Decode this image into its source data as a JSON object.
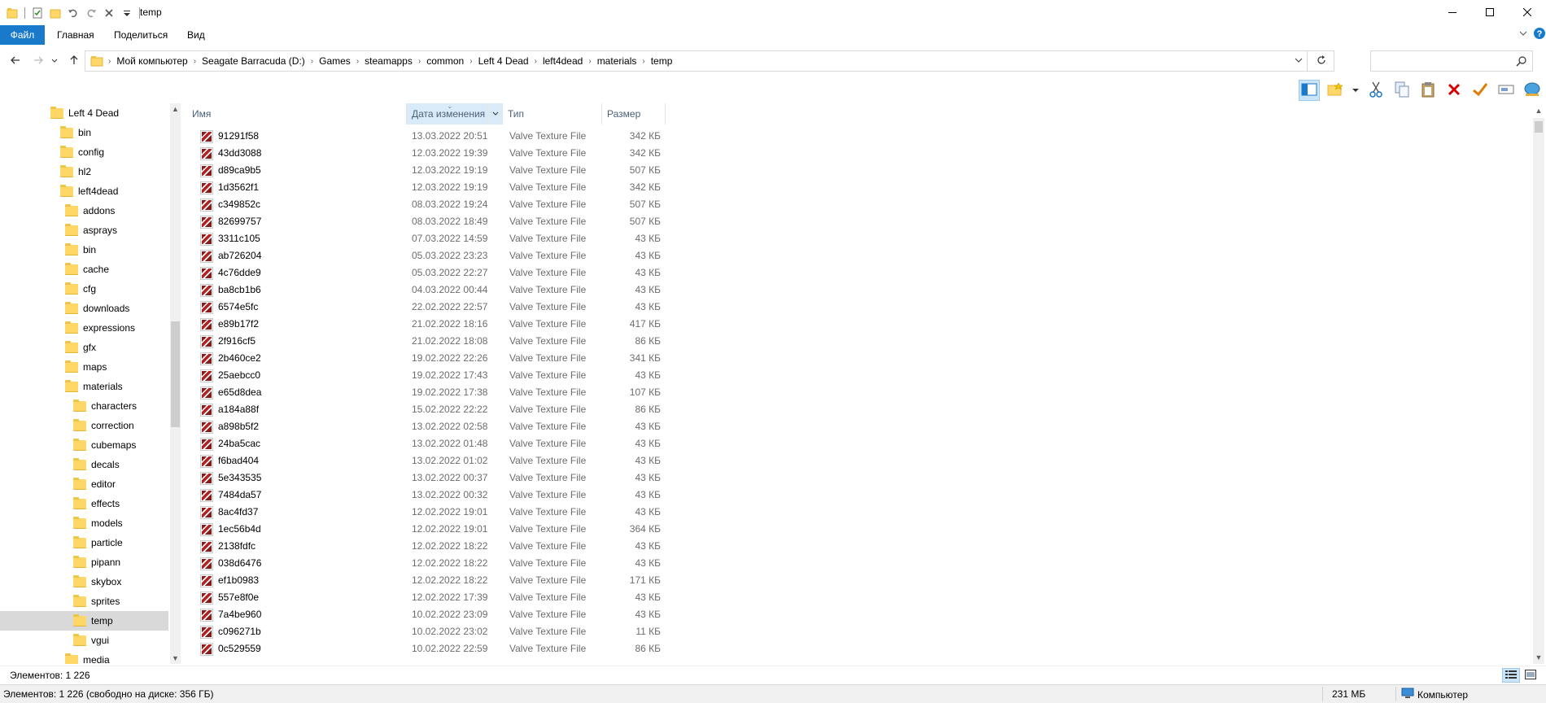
{
  "window": {
    "title": "temp",
    "min_icon": "minimize-icon",
    "max_icon": "maximize-icon",
    "close_icon": "close-icon"
  },
  "ribbon": {
    "tabs": [
      "Файл",
      "Главная",
      "Поделиться",
      "Вид"
    ]
  },
  "address": {
    "crumbs": [
      "Мой компьютер",
      "Seagate Barracuda (D:)",
      "Games",
      "steamapps",
      "common",
      "Left 4 Dead",
      "left4dead",
      "materials",
      "temp"
    ],
    "search_placeholder": ""
  },
  "nav": {
    "items": [
      {
        "label": "Left 4 Dead",
        "indent": 0
      },
      {
        "label": "bin",
        "indent": 1
      },
      {
        "label": "config",
        "indent": 1
      },
      {
        "label": "hl2",
        "indent": 1
      },
      {
        "label": "left4dead",
        "indent": 1
      },
      {
        "label": "addons",
        "indent": 2
      },
      {
        "label": "asprays",
        "indent": 2
      },
      {
        "label": "bin",
        "indent": 2
      },
      {
        "label": "cache",
        "indent": 2
      },
      {
        "label": "cfg",
        "indent": 2
      },
      {
        "label": "downloads",
        "indent": 2
      },
      {
        "label": "expressions",
        "indent": 2
      },
      {
        "label": "gfx",
        "indent": 2
      },
      {
        "label": "maps",
        "indent": 2
      },
      {
        "label": "materials",
        "indent": 2
      },
      {
        "label": "characters",
        "indent": 3
      },
      {
        "label": "correction",
        "indent": 3
      },
      {
        "label": "cubemaps",
        "indent": 3
      },
      {
        "label": "decals",
        "indent": 3
      },
      {
        "label": "editor",
        "indent": 3
      },
      {
        "label": "effects",
        "indent": 3
      },
      {
        "label": "models",
        "indent": 3
      },
      {
        "label": "particle",
        "indent": 3
      },
      {
        "label": "pipann",
        "indent": 3
      },
      {
        "label": "skybox",
        "indent": 3
      },
      {
        "label": "sprites",
        "indent": 3
      },
      {
        "label": "temp",
        "indent": 3,
        "selected": true
      },
      {
        "label": "vgui",
        "indent": 3
      },
      {
        "label": "media",
        "indent": 2
      }
    ]
  },
  "columns": {
    "name": "Имя",
    "date": "Дата изменения",
    "type": "Тип",
    "size": "Размер"
  },
  "files": [
    {
      "name": "91291f58",
      "date": "13.03.2022 20:51",
      "type": "Valve Texture File",
      "size": "342 КБ"
    },
    {
      "name": "43dd3088",
      "date": "12.03.2022 19:39",
      "type": "Valve Texture File",
      "size": "342 КБ"
    },
    {
      "name": "d89ca9b5",
      "date": "12.03.2022 19:19",
      "type": "Valve Texture File",
      "size": "507 КБ"
    },
    {
      "name": "1d3562f1",
      "date": "12.03.2022 19:19",
      "type": "Valve Texture File",
      "size": "342 КБ"
    },
    {
      "name": "c349852c",
      "date": "08.03.2022 19:24",
      "type": "Valve Texture File",
      "size": "507 КБ"
    },
    {
      "name": "82699757",
      "date": "08.03.2022 18:49",
      "type": "Valve Texture File",
      "size": "507 КБ"
    },
    {
      "name": "3311c105",
      "date": "07.03.2022 14:59",
      "type": "Valve Texture File",
      "size": "43 КБ"
    },
    {
      "name": "ab726204",
      "date": "05.03.2022 23:23",
      "type": "Valve Texture File",
      "size": "43 КБ"
    },
    {
      "name": "4c76dde9",
      "date": "05.03.2022 22:27",
      "type": "Valve Texture File",
      "size": "43 КБ"
    },
    {
      "name": "ba8cb1b6",
      "date": "04.03.2022 00:44",
      "type": "Valve Texture File",
      "size": "43 КБ"
    },
    {
      "name": "6574e5fc",
      "date": "22.02.2022 22:57",
      "type": "Valve Texture File",
      "size": "43 КБ"
    },
    {
      "name": "e89b17f2",
      "date": "21.02.2022 18:16",
      "type": "Valve Texture File",
      "size": "417 КБ"
    },
    {
      "name": "2f916cf5",
      "date": "21.02.2022 18:08",
      "type": "Valve Texture File",
      "size": "86 КБ"
    },
    {
      "name": "2b460ce2",
      "date": "19.02.2022 22:26",
      "type": "Valve Texture File",
      "size": "341 КБ"
    },
    {
      "name": "25aebcc0",
      "date": "19.02.2022 17:43",
      "type": "Valve Texture File",
      "size": "43 КБ"
    },
    {
      "name": "e65d8dea",
      "date": "19.02.2022 17:38",
      "type": "Valve Texture File",
      "size": "107 КБ"
    },
    {
      "name": "a184a88f",
      "date": "15.02.2022 22:22",
      "type": "Valve Texture File",
      "size": "86 КБ"
    },
    {
      "name": "a898b5f2",
      "date": "13.02.2022 02:58",
      "type": "Valve Texture File",
      "size": "43 КБ"
    },
    {
      "name": "24ba5cac",
      "date": "13.02.2022 01:48",
      "type": "Valve Texture File",
      "size": "43 КБ"
    },
    {
      "name": "f6bad404",
      "date": "13.02.2022 01:02",
      "type": "Valve Texture File",
      "size": "43 КБ"
    },
    {
      "name": "5e343535",
      "date": "13.02.2022 00:37",
      "type": "Valve Texture File",
      "size": "43 КБ"
    },
    {
      "name": "7484da57",
      "date": "13.02.2022 00:32",
      "type": "Valve Texture File",
      "size": "43 КБ"
    },
    {
      "name": "8ac4fd37",
      "date": "12.02.2022 19:01",
      "type": "Valve Texture File",
      "size": "43 КБ"
    },
    {
      "name": "1ec56b4d",
      "date": "12.02.2022 19:01",
      "type": "Valve Texture File",
      "size": "364 КБ"
    },
    {
      "name": "2138fdfc",
      "date": "12.02.2022 18:22",
      "type": "Valve Texture File",
      "size": "43 КБ"
    },
    {
      "name": "038d6476",
      "date": "12.02.2022 18:22",
      "type": "Valve Texture File",
      "size": "43 КБ"
    },
    {
      "name": "ef1b0983",
      "date": "12.02.2022 18:22",
      "type": "Valve Texture File",
      "size": "171 КБ"
    },
    {
      "name": "557e8f0e",
      "date": "12.02.2022 17:39",
      "type": "Valve Texture File",
      "size": "43 КБ"
    },
    {
      "name": "7a4be960",
      "date": "10.02.2022 23:09",
      "type": "Valve Texture File",
      "size": "43 КБ"
    },
    {
      "name": "c096271b",
      "date": "10.02.2022 23:02",
      "type": "Valve Texture File",
      "size": "11 КБ"
    },
    {
      "name": "0c529559",
      "date": "10.02.2022 22:59",
      "type": "Valve Texture File",
      "size": "86 КБ"
    }
  ],
  "status": {
    "items_count": "Элементов: 1 226",
    "bottom_left": "Элементов: 1 226 (свободно на диске: 356 ГБ)",
    "size": "231 МБ",
    "computer": "Компьютер"
  },
  "colors": {
    "accent": "#1979ca",
    "selection": "#cce4f7",
    "folder": "#ffd767"
  }
}
